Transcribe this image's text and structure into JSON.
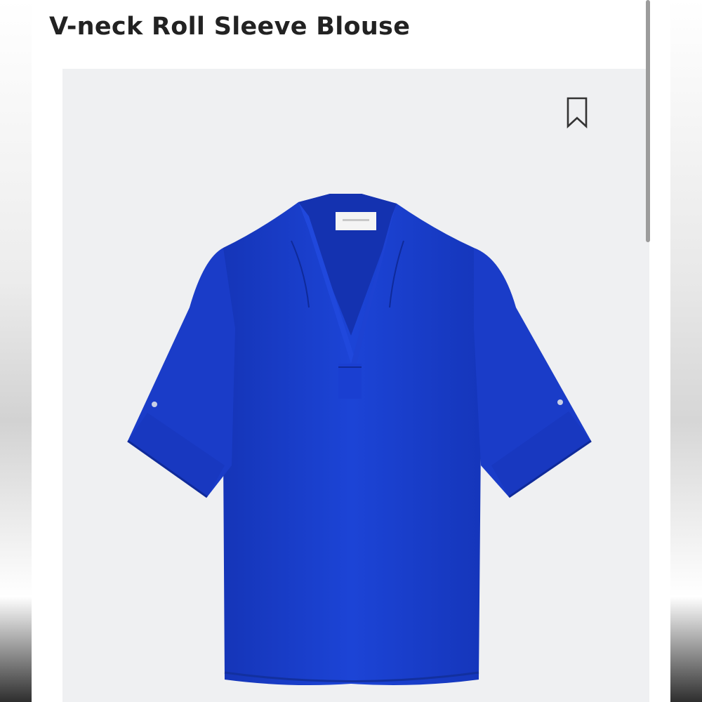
{
  "product": {
    "title": "V-neck Roll Sleeve Blouse",
    "image_icon": "blouse-photo",
    "garment_color": "#1a3fd1"
  },
  "actions": {
    "bookmark_icon": "bookmark-icon"
  },
  "colors": {
    "image_background": "#eff0f2",
    "title_text": "#222222"
  }
}
